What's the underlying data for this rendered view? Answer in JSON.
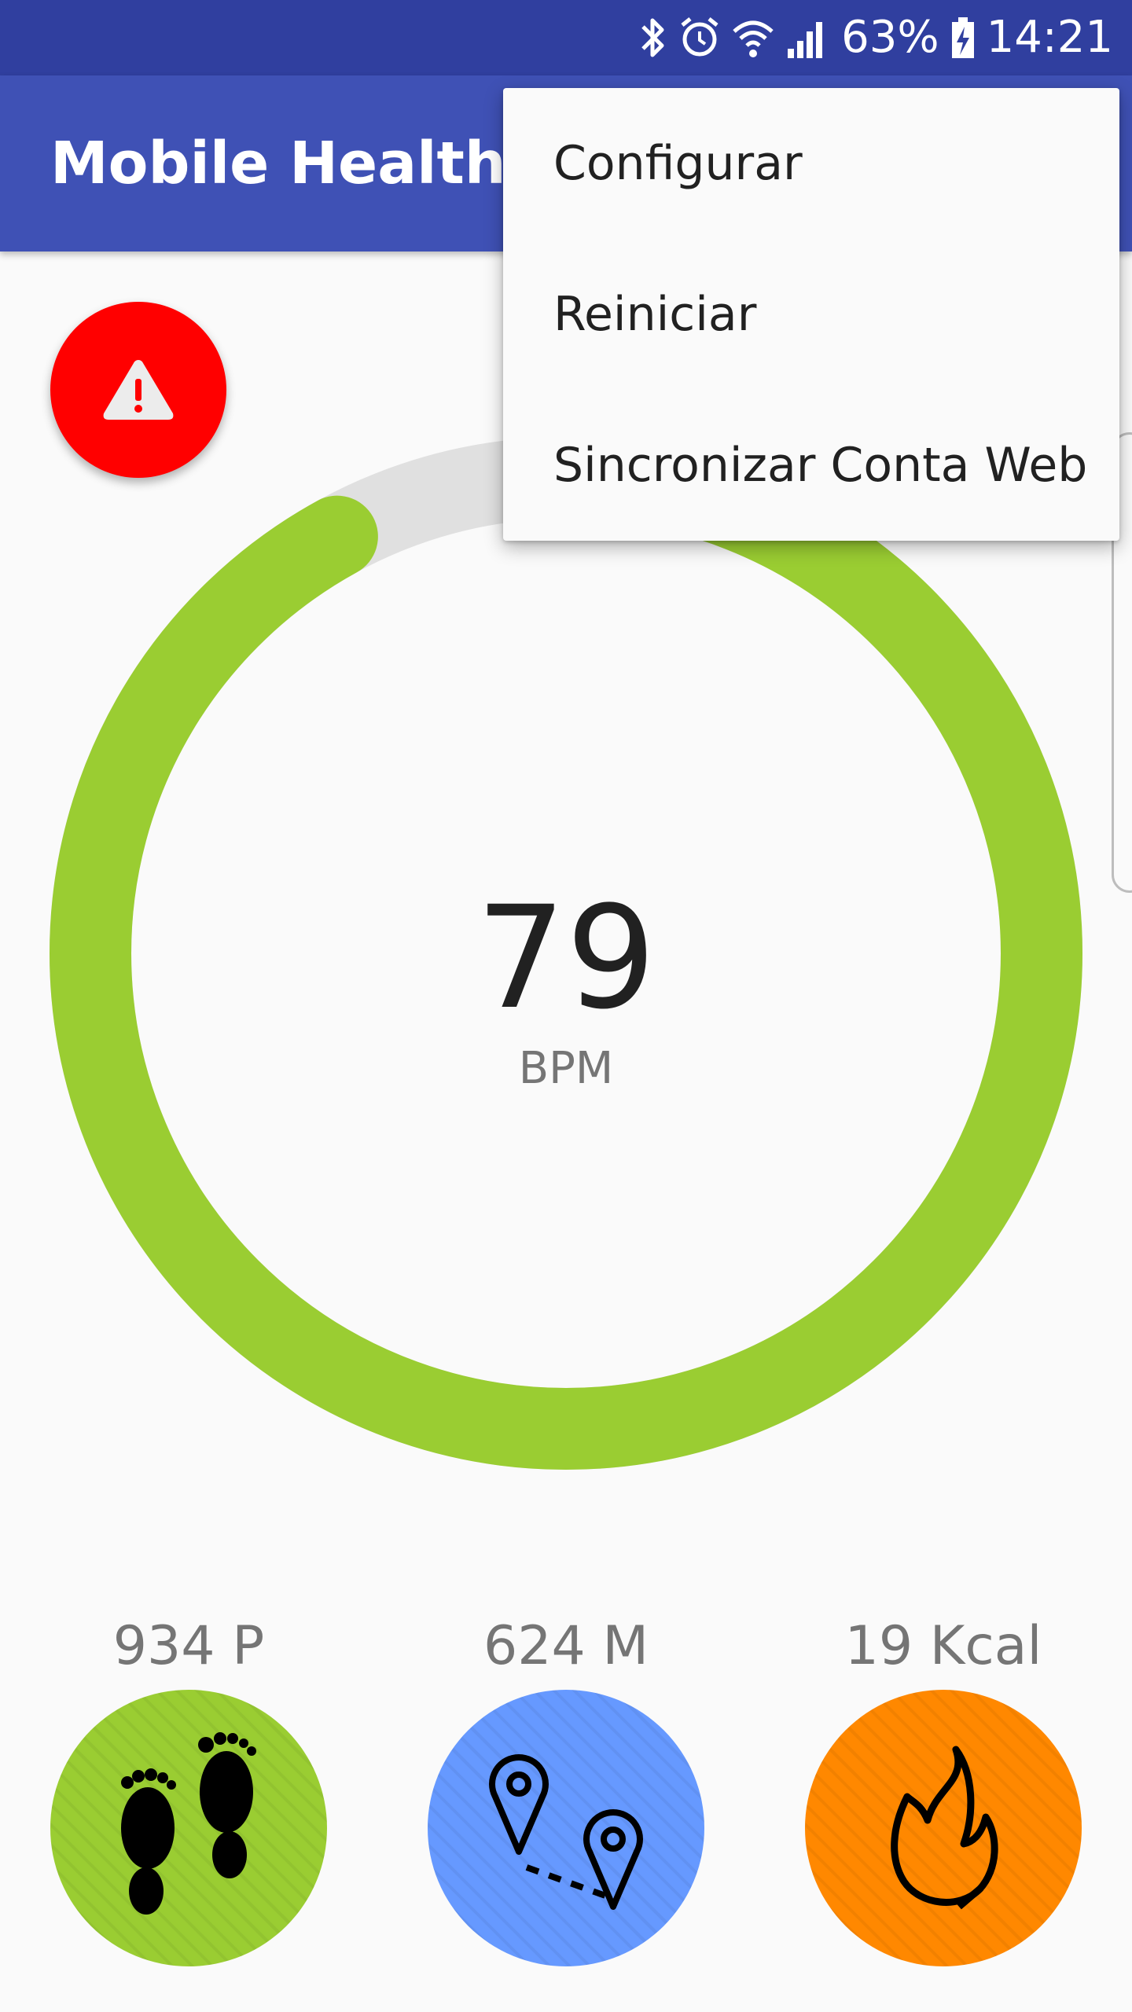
{
  "status_bar": {
    "battery": "63%",
    "time": "14:21",
    "icons": [
      "bluetooth-icon",
      "alarm-icon",
      "wifi-icon",
      "signal-icon",
      "battery-charging-icon"
    ]
  },
  "app_bar": {
    "title": "Mobile Health App"
  },
  "alert": {
    "icon": "warning-icon",
    "color": "#ff0000"
  },
  "heart_rate": {
    "value": "79",
    "unit": "BPM",
    "progress_fraction": 0.92,
    "color": "#9acd32",
    "track_color": "#e0e0e0"
  },
  "stats": [
    {
      "label": "934 P",
      "icon": "footprints-icon",
      "color": "#9acd32"
    },
    {
      "label": "624 M",
      "icon": "route-pins-icon",
      "color": "#6699ff"
    },
    {
      "label": "19 Kcal",
      "icon": "flame-icon",
      "color": "#ff8800"
    }
  ],
  "overflow_menu": {
    "items": [
      {
        "label": "Configurar"
      },
      {
        "label": "Reiniciar"
      },
      {
        "label": "Sincronizar Conta Web"
      }
    ]
  }
}
